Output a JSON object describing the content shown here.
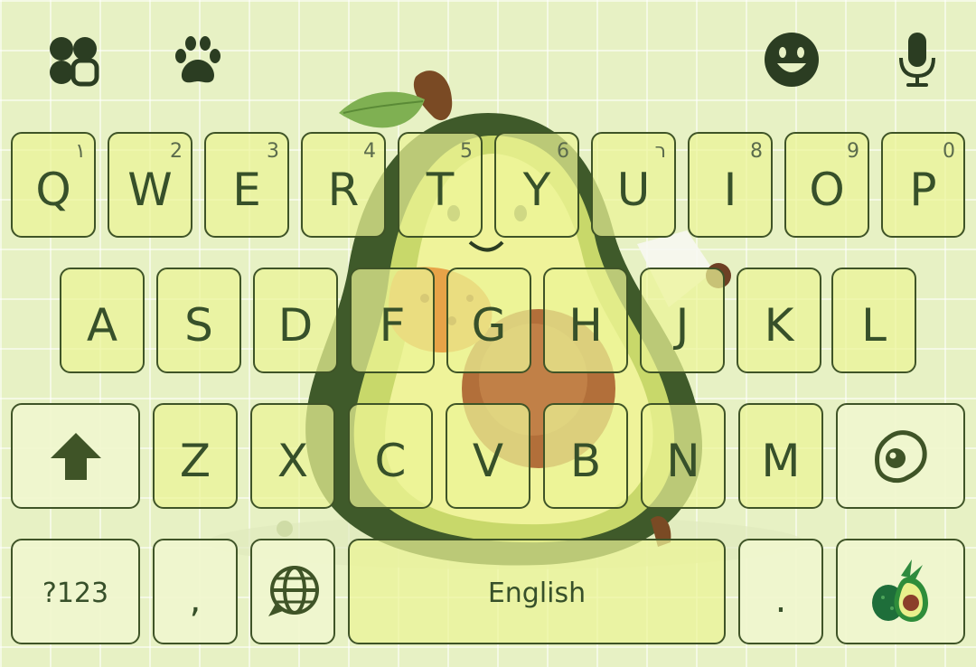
{
  "theme": {
    "background": "#e7f1c4",
    "key_fill": "#eef497",
    "key_border": "#3f5427",
    "key_text": "#37502a",
    "icon_color": "#2b3d22"
  },
  "toolbar": {
    "left_icons": [
      {
        "icon": "clover-icon"
      },
      {
        "icon": "paw-icon"
      }
    ],
    "right_icons": [
      {
        "icon": "emoji-icon"
      },
      {
        "icon": "microphone-icon"
      }
    ]
  },
  "rows": {
    "row1": [
      {
        "label": "Q",
        "hint": "١"
      },
      {
        "label": "W",
        "hint": "2"
      },
      {
        "label": "E",
        "hint": "3"
      },
      {
        "label": "R",
        "hint": "4"
      },
      {
        "label": "T",
        "hint": "5"
      },
      {
        "label": "Y",
        "hint": "6"
      },
      {
        "label": "U",
        "hint": "ר"
      },
      {
        "label": "I",
        "hint": "8"
      },
      {
        "label": "O",
        "hint": "9"
      },
      {
        "label": "P",
        "hint": "0"
      }
    ],
    "row2": [
      {
        "label": "A"
      },
      {
        "label": "S"
      },
      {
        "label": "D"
      },
      {
        "label": "F"
      },
      {
        "label": "G"
      },
      {
        "label": "H"
      },
      {
        "label": "J"
      },
      {
        "label": "K"
      },
      {
        "label": "L"
      }
    ],
    "row3": [
      {
        "label": "Z"
      },
      {
        "label": "X"
      },
      {
        "label": "C"
      },
      {
        "label": "V"
      },
      {
        "label": "B"
      },
      {
        "label": "N"
      },
      {
        "label": "M"
      }
    ]
  },
  "bottom": {
    "symbols_label": "?123",
    "comma_label": ",",
    "space_label": "English",
    "period_label": "."
  },
  "icons": {
    "shift": "shift-arrow-icon",
    "backspace": "fried-egg-icon",
    "language": "globe-chat-icon",
    "enter": "avocado-icon"
  }
}
